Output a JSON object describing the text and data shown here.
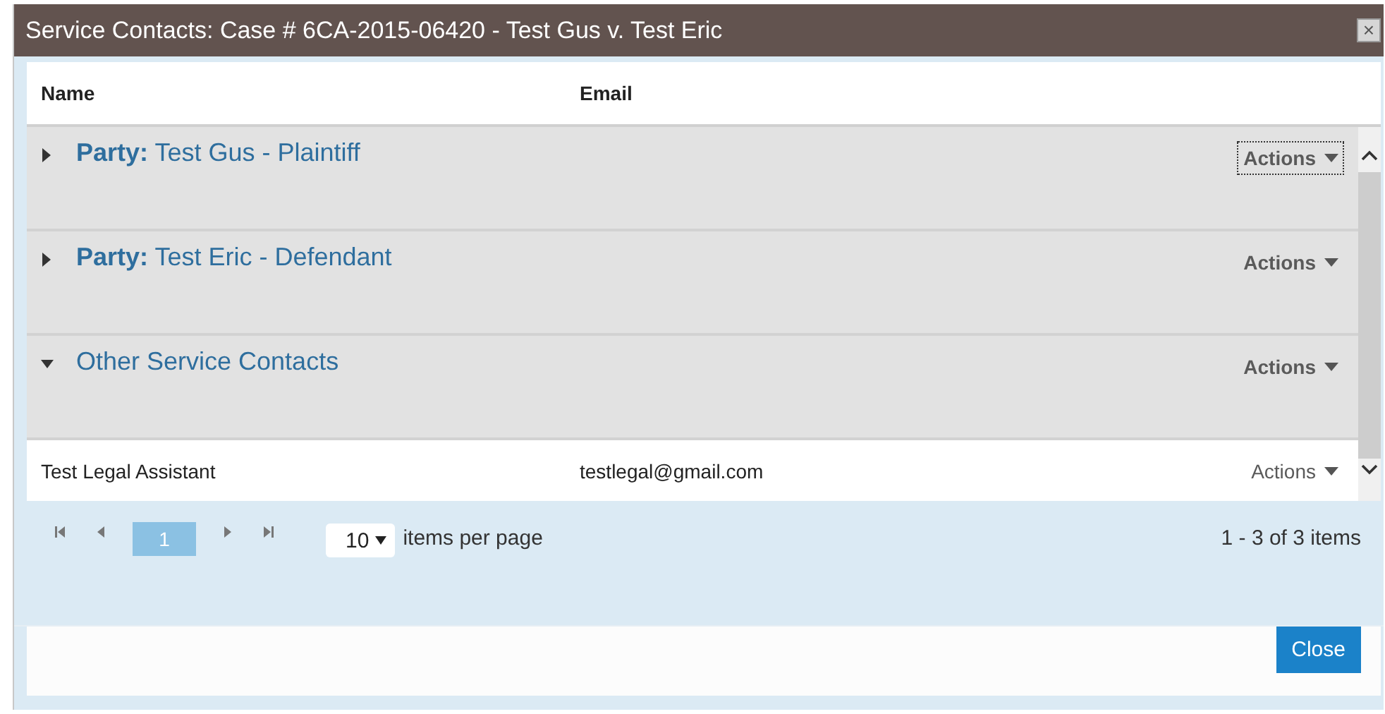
{
  "window": {
    "title": "Service Contacts: Case # 6CA-2015-06420 - Test Gus v. Test Eric",
    "close_icon": "×"
  },
  "table": {
    "columns": [
      "Name",
      "Email"
    ],
    "groups": [
      {
        "label": "**Party:** Test Gus - Plaintiff",
        "expanded": false,
        "actions": "Actions",
        "focused": true
      },
      {
        "label": "**Party:** Test Eric - Defendant",
        "expanded": false,
        "actions": "Actions",
        "focused": false
      },
      {
        "label": "Other Service Contacts",
        "expanded": true,
        "actions": "Actions",
        "focused": false,
        "rows": [
          {
            "name": "Test Legal Assistant",
            "email": "testlegal@gmail.com",
            "actions": "Actions"
          }
        ]
      }
    ]
  },
  "pager": {
    "pages": [
      {
        "label": "1",
        "selected": true
      }
    ],
    "page_size": "10",
    "page_size_label": "items per page",
    "summary": "1 - 3 of 3 items"
  },
  "buttons": [
    "Close"
  ]
}
